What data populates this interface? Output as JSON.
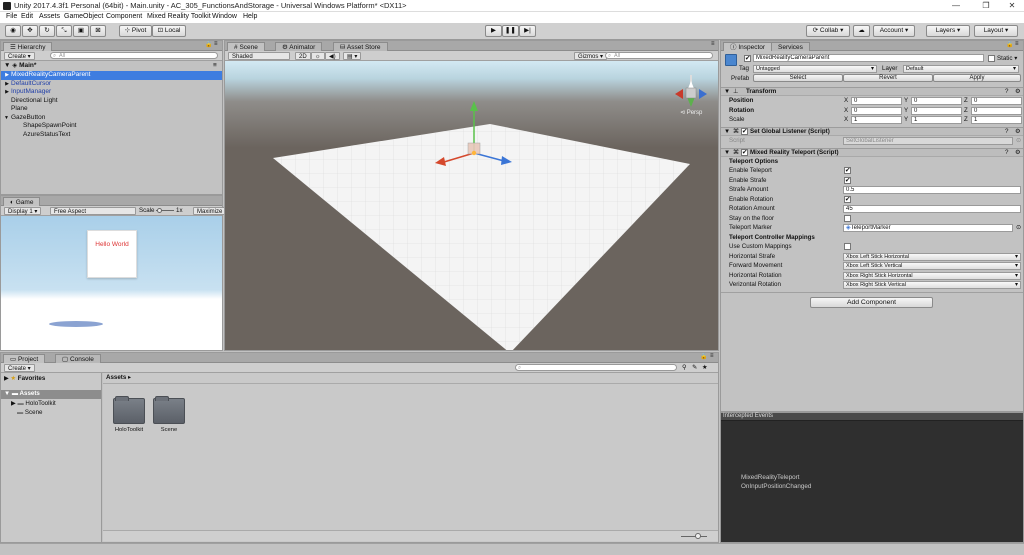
{
  "window": {
    "title": "Unity 2017.4.3f1 Personal (64bit) - Main.unity - AC_305_FunctionsAndStorage - Universal Windows Platform* <DX11>",
    "controls": [
      "—",
      "❐",
      "✕"
    ]
  },
  "menu": [
    "File",
    "Edit",
    "Assets",
    "GameObject",
    "Component",
    "Mixed Reality Toolkit",
    "Window",
    "Help"
  ],
  "toolbar": {
    "pivot": "Pivot",
    "local": "Local",
    "collab": "Collab",
    "account": "Account",
    "layers": "Layers",
    "layout": "Layout"
  },
  "hierarchy": {
    "tab": "Hierarchy",
    "create": "Create",
    "search_placeholder": "All",
    "scene": "Main*",
    "items": [
      {
        "label": "MixedRealityCameraParent",
        "indent": 1,
        "arrow": "▶"
      },
      {
        "label": "DefaultCursor",
        "indent": 1,
        "arrow": "▶"
      },
      {
        "label": "InputManager",
        "indent": 1,
        "arrow": "▶"
      },
      {
        "label": "Directional Light",
        "indent": 1,
        "arrow": ""
      },
      {
        "label": "Plane",
        "indent": 1,
        "arrow": ""
      },
      {
        "label": "GazeButton",
        "indent": 1,
        "arrow": "▼"
      },
      {
        "label": "ShapeSpawnPoint",
        "indent": 2,
        "arrow": ""
      },
      {
        "label": "AzureStatusText",
        "indent": 2,
        "arrow": ""
      }
    ]
  },
  "game": {
    "tab": "Game",
    "display": "Display 1",
    "aspect": "Free Aspect",
    "scale_label": "Scale",
    "scale_value": "1x",
    "maximize": "Maximize O",
    "hello": "Hello World"
  },
  "scene": {
    "tabs": [
      "Scene",
      "Animator",
      "Asset Store"
    ],
    "shading": "Shaded",
    "mode2d": "2D",
    "gizmos": "Gizmos",
    "search_placeholder": "All",
    "persp": "Persp"
  },
  "inspector": {
    "tabs": [
      "Inspector",
      "Services"
    ],
    "object_name": "MixedRealityCameraParent",
    "static_label": "Static",
    "tag_label": "Tag",
    "tag_value": "Untagged",
    "layer_label": "Layer",
    "layer_value": "Default",
    "prefab_label": "Prefab",
    "prefab_buttons": [
      "Select",
      "Revert",
      "Apply"
    ],
    "transform": {
      "title": "Transform",
      "rows": [
        {
          "label": "Position",
          "x": "0",
          "y": "0",
          "z": "0"
        },
        {
          "label": "Rotation",
          "x": "0",
          "y": "0",
          "z": "0"
        },
        {
          "label": "Scale",
          "x": "1",
          "y": "1",
          "z": "1"
        }
      ],
      "axes": [
        "X",
        "Y",
        "Z"
      ]
    },
    "set_global_listener": {
      "title": "Set Global Listener (Script)",
      "script_label": "Script",
      "script_value": "SetGlobalListener"
    },
    "teleport": {
      "title": "Mixed Reality Teleport (Script)",
      "options_header": "Teleport Options",
      "enable_teleport": "Enable Teleport",
      "enable_strafe": "Enable Strafe",
      "strafe_amount_label": "Strafe Amount",
      "strafe_amount": "0.5",
      "enable_rotation": "Enable Rotation",
      "rotation_amount_label": "Rotation Amount",
      "rotation_amount": "45",
      "stay_on_floor": "Stay on the floor",
      "marker_label": "Teleport Marker",
      "marker_value": "TeleportMarker",
      "mappings_header": "Teleport Controller Mappings",
      "use_custom": "Use Custom Mappings",
      "h_strafe_label": "Horizontal Strafe",
      "h_strafe": "Xbox Left Stick Horizontal",
      "fwd_label": "Forward Movement",
      "fwd": "Xbox Left Stick Vertical",
      "h_rot_label": "Horizontal Rotation",
      "h_rot": "Xbox Right Stick Horizontal",
      "v_rot_label": "Verizontal Rotation",
      "v_rot": "Xbox Right Stick Vertical",
      "check": "✔"
    },
    "add_component": "Add Component"
  },
  "events": {
    "title": "Intercepted Events",
    "line1": "MixedRealityTeleport",
    "line2": "OnInputPositionChanged"
  },
  "project": {
    "tabs": [
      "Project",
      "Console"
    ],
    "create": "Create",
    "favorites": "Favorites",
    "assets": "Assets",
    "tree": [
      "HoloToolkit",
      "Scene"
    ],
    "breadcrumb": "Assets",
    "folders": [
      "HoloToolkit",
      "Scene"
    ]
  },
  "colors": {
    "selection": "#3e7de0",
    "sky": "#a9cfe9",
    "scene_ground": "#6b645e",
    "events_bg": "#2f2f2f"
  }
}
